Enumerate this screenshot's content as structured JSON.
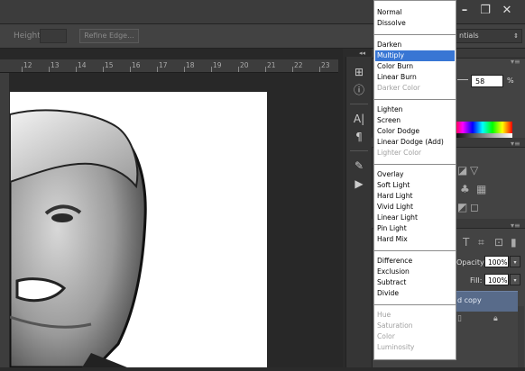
{
  "window": {
    "minimize": "–",
    "restore": "❐",
    "close": "✕"
  },
  "options_bar": {
    "height_label": "Height:",
    "refine_edge_label": "Refine Edge...",
    "workspace_value": "ntials"
  },
  "ruler": {
    "ticks": [
      "12",
      "13",
      "14",
      "15",
      "16",
      "17",
      "18",
      "19",
      "20",
      "21",
      "22",
      "23"
    ]
  },
  "panels": {
    "collapse_arrows": "◂◂",
    "menu_icon": "▾≡"
  },
  "tools": [
    {
      "icon": "adjust-layers-icon",
      "glyph": "⊞"
    },
    {
      "icon": "info-icon",
      "glyph": "ⓘ"
    },
    {
      "icon": "character-icon",
      "glyph": "A|"
    },
    {
      "icon": "paragraph-icon",
      "glyph": "¶"
    },
    {
      "icon": "brush-presets-icon",
      "glyph": "✎"
    },
    {
      "icon": "play-action-icon",
      "glyph": "▶"
    }
  ],
  "color_panel": {
    "opacity_value": "58",
    "opacity_unit": "%"
  },
  "layers_panel": {
    "opacity_label": "Opacity:",
    "opacity_value": "100%",
    "fill_label": "Fill:",
    "fill_value": "100%",
    "selected_layer_label": "d copy"
  },
  "blend_mode_menu": {
    "groups": [
      [
        {
          "label": "Normal",
          "enabled": true
        },
        {
          "label": "Dissolve",
          "enabled": true
        }
      ],
      [
        {
          "label": "Darken",
          "enabled": true
        },
        {
          "label": "Multiply",
          "enabled": true,
          "selected": true
        },
        {
          "label": "Color Burn",
          "enabled": true
        },
        {
          "label": "Linear Burn",
          "enabled": true
        },
        {
          "label": "Darker Color",
          "enabled": false
        }
      ],
      [
        {
          "label": "Lighten",
          "enabled": true
        },
        {
          "label": "Screen",
          "enabled": true
        },
        {
          "label": "Color Dodge",
          "enabled": true
        },
        {
          "label": "Linear Dodge (Add)",
          "enabled": true
        },
        {
          "label": "Lighter Color",
          "enabled": false
        }
      ],
      [
        {
          "label": "Overlay",
          "enabled": true
        },
        {
          "label": "Soft Light",
          "enabled": true
        },
        {
          "label": "Hard Light",
          "enabled": true
        },
        {
          "label": "Vivid Light",
          "enabled": true
        },
        {
          "label": "Linear Light",
          "enabled": true
        },
        {
          "label": "Pin Light",
          "enabled": true
        },
        {
          "label": "Hard Mix",
          "enabled": true
        }
      ],
      [
        {
          "label": "Difference",
          "enabled": true
        },
        {
          "label": "Exclusion",
          "enabled": true
        },
        {
          "label": "Subtract",
          "enabled": true
        },
        {
          "label": "Divide",
          "enabled": true
        }
      ],
      [
        {
          "label": "Hue",
          "enabled": false
        },
        {
          "label": "Saturation",
          "enabled": false
        },
        {
          "label": "Color",
          "enabled": false
        },
        {
          "label": "Luminosity",
          "enabled": false
        }
      ]
    ]
  },
  "colors": {
    "selection": "#3876d4",
    "panel_bg": "#434343",
    "app_bg": "#2b2b2b"
  }
}
